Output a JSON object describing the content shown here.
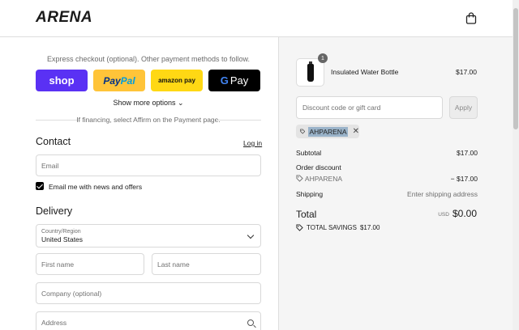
{
  "header": {
    "logo": "ARENA",
    "cart_icon": "shopping-bag-icon"
  },
  "express": {
    "label": "Express checkout (optional). Other payment methods to follow.",
    "buttons": {
      "shop": "shop",
      "paypal_a": "Pay",
      "paypal_b": "Pal",
      "amazon": "amazon pay",
      "gpay_g": "G",
      "gpay_text": "Pay"
    },
    "show_more": "Show more options ⌄",
    "financing_note": "If financing, select Affirm on the Payment page."
  },
  "contact": {
    "title": "Contact",
    "login": "Log in",
    "email_placeholder": "Email",
    "newsletter_label": "Email me with news and offers",
    "newsletter_checked": true
  },
  "delivery": {
    "title": "Delivery",
    "country_label": "Country/Region",
    "country_value": "United States",
    "first_name_placeholder": "First name",
    "last_name_placeholder": "Last name",
    "company_placeholder": "Company (optional)",
    "address_placeholder": "Address"
  },
  "summary": {
    "item": {
      "name": "Insulated Water Bottle",
      "price": "$17.00",
      "quantity": "1"
    },
    "discount_placeholder": "Discount code or gift card",
    "apply_label": "Apply",
    "applied_code": "AHPARENA",
    "subtotal_label": "Subtotal",
    "subtotal_value": "$17.00",
    "order_discount_label": "Order discount",
    "discount_code": "AHPARENA",
    "discount_value": "− $17.00",
    "shipping_label": "Shipping",
    "shipping_value": "Enter shipping address",
    "total_label": "Total",
    "currency": "USD",
    "total_value": "$0.00",
    "savings_label": "TOTAL SAVINGS",
    "savings_value": "$17.00"
  }
}
